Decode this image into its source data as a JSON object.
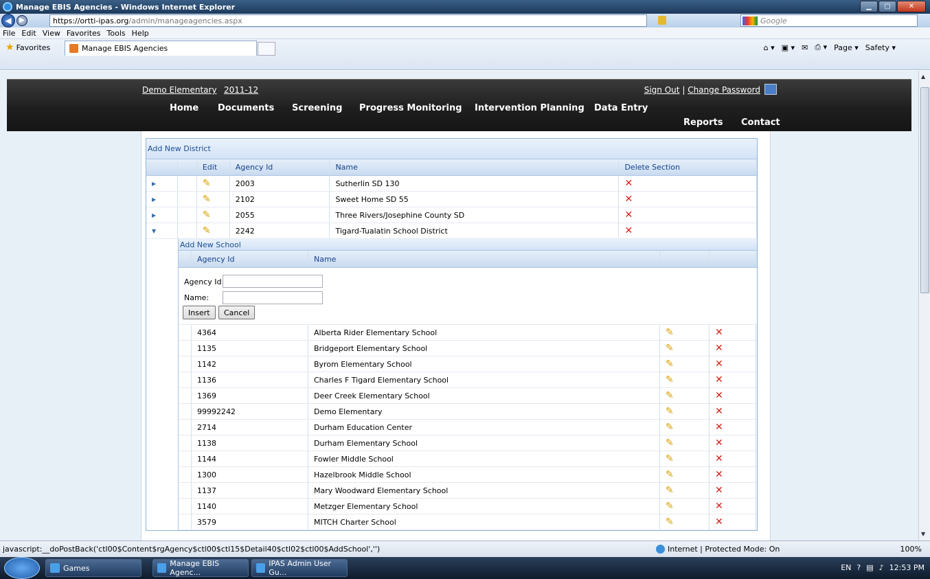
{
  "browser": {
    "window_title": "Manage EBIS Agencies - Windows Internet Explorer",
    "url_host": "https://ortti-ipas.org",
    "url_path": "/admin/manageagencies.aspx",
    "search_placeholder": "Google",
    "menu": [
      "File",
      "Edit",
      "View",
      "Favorites",
      "Tools",
      "Help"
    ],
    "favorites_label": "Favorites",
    "tab_label": "Manage EBIS Agencies",
    "cmd": [
      "Page ▾",
      "Safety ▾"
    ],
    "status_text": "javascript:__doPostBack('ctl00$Content$rgAgency$ctl00$ctl15$Detail40$ctl02$ctl00$AddSchool','')",
    "zone": "Internet | Protected Mode: On",
    "zoom": "100%"
  },
  "taskbar": {
    "items": [
      "Games",
      "Manage EBIS Agenc...",
      "IPAS Admin User Gu..."
    ],
    "lang": "EN",
    "clock": "12:53 PM"
  },
  "site": {
    "school": "Demo Elementary",
    "year": "2011-12",
    "sign_out": "Sign Out",
    "separator": "|",
    "change_password": "Change Password",
    "nav": [
      "Home",
      "Documents",
      "Screening",
      "Progress Monitoring",
      "Intervention Planning",
      "Data Entry",
      "Reports",
      "Contact"
    ]
  },
  "grid": {
    "add_label": "Add New District",
    "headers": [
      "Edit",
      "Agency Id",
      "Name",
      "Delete Section"
    ],
    "rows": [
      {
        "id": "2003",
        "name": "Sutherlin SD 130"
      },
      {
        "id": "2102",
        "name": "Sweet Home SD 55"
      },
      {
        "id": "2055",
        "name": "Three Rivers/Josephine County SD"
      },
      {
        "id": "2242",
        "name": "Tigard-Tualatin School District"
      }
    ]
  },
  "detail": {
    "add_label": "Add New School",
    "headers": [
      "Agency Id",
      "Name"
    ],
    "form": {
      "id_label": "Agency Id:",
      "name_label": "Name:",
      "insert": "Insert",
      "cancel": "Cancel"
    },
    "rows": [
      {
        "id": "4364",
        "name": "Alberta Rider Elementary School"
      },
      {
        "id": "1135",
        "name": "Bridgeport Elementary School"
      },
      {
        "id": "1142",
        "name": "Byrom Elementary School"
      },
      {
        "id": "1136",
        "name": "Charles F Tigard Elementary School"
      },
      {
        "id": "1369",
        "name": "Deer Creek Elementary School"
      },
      {
        "id": "99992242",
        "name": "Demo Elementary"
      },
      {
        "id": "2714",
        "name": "Durham Education Center"
      },
      {
        "id": "1138",
        "name": "Durham Elementary School"
      },
      {
        "id": "1144",
        "name": "Fowler Middle School"
      },
      {
        "id": "1300",
        "name": "Hazelbrook Middle School"
      },
      {
        "id": "1137",
        "name": "Mary Woodward Elementary School"
      },
      {
        "id": "1140",
        "name": "Metzger Elementary School"
      },
      {
        "id": "3579",
        "name": "MITCH Charter School"
      }
    ]
  }
}
